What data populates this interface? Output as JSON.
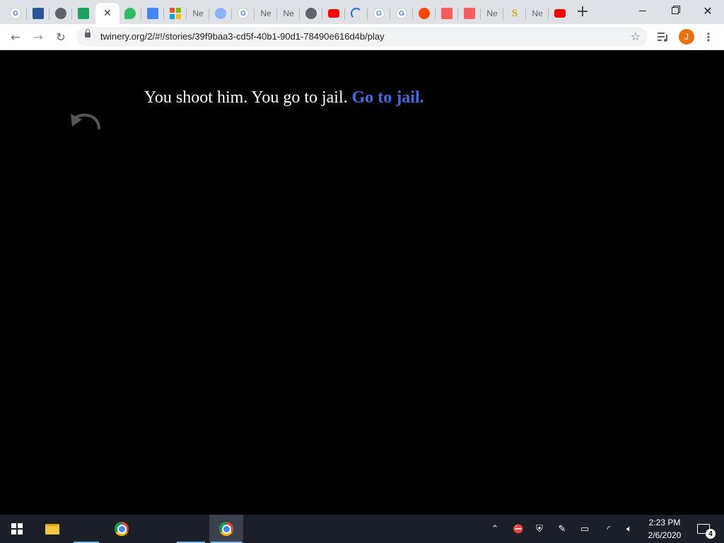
{
  "tabs": [
    {
      "name": "google",
      "glyph": "G"
    },
    {
      "name": "notebook",
      "glyph": ""
    },
    {
      "name": "globe",
      "glyph": ""
    },
    {
      "name": "bookmark",
      "glyph": ""
    },
    {
      "name": "twinery-active",
      "glyph": "✕"
    },
    {
      "name": "evernote",
      "glyph": ""
    },
    {
      "name": "docs",
      "glyph": ""
    },
    {
      "name": "microsoft",
      "glyph": ""
    },
    {
      "name": "new-tab-1",
      "glyph": "Ne"
    },
    {
      "name": "avatar-site",
      "glyph": ""
    },
    {
      "name": "google-2",
      "glyph": "G"
    },
    {
      "name": "new-tab-2",
      "glyph": "Ne"
    },
    {
      "name": "new-tab-3",
      "glyph": "Ne"
    },
    {
      "name": "globe-2",
      "glyph": ""
    },
    {
      "name": "youtube",
      "glyph": ""
    },
    {
      "name": "loading",
      "glyph": ""
    },
    {
      "name": "google-3",
      "glyph": "G"
    },
    {
      "name": "google-4",
      "glyph": "G"
    },
    {
      "name": "reddit",
      "glyph": ""
    },
    {
      "name": "itch-1",
      "glyph": ""
    },
    {
      "name": "itch-2",
      "glyph": ""
    },
    {
      "name": "new-tab-4",
      "glyph": "Ne"
    },
    {
      "name": "scratch",
      "glyph": "S"
    },
    {
      "name": "new-tab-5",
      "glyph": "Ne"
    },
    {
      "name": "youtube-2",
      "glyph": ""
    }
  ],
  "toolbar": {
    "url": "twinery.org/2/#!/stories/39f9baa3-cd5f-40b1-90d1-78490e616d4b/play",
    "profile_initial": "J"
  },
  "passage": {
    "text": "You shoot him. You go to jail. ",
    "link_text": "Go to jail."
  },
  "taskbar": {
    "time": "2:23 PM",
    "date": "2/6/2020",
    "notification_count": "4"
  },
  "colors": {
    "link": "#4169e1",
    "background": "#000000",
    "tabstrip": "#dee1e6",
    "taskbar": "#1b2028",
    "avatar": "#e8710a"
  }
}
